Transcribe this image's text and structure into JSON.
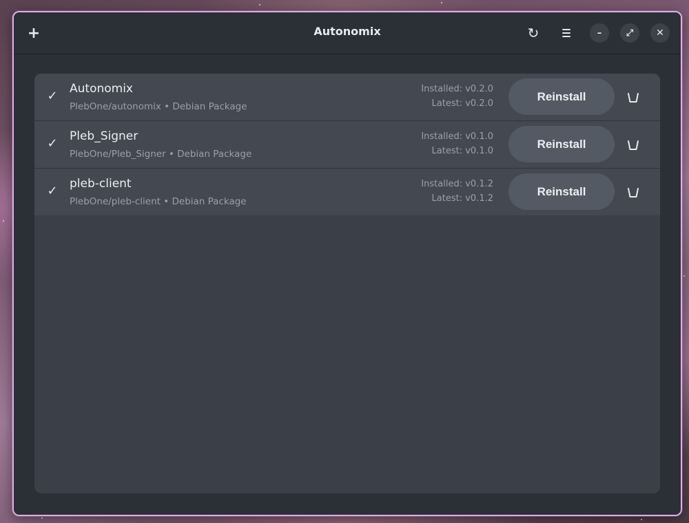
{
  "window": {
    "title": "Autonomix",
    "add_label": "+",
    "refresh_label": "↻",
    "minimize_label": "–",
    "maximize_label": "⤢",
    "close_label": "✕"
  },
  "apps": [
    {
      "name": "Autonomix",
      "subtitle": "PlebOne/autonomix • Debian Package",
      "installed": "Installed: v0.2.0",
      "latest": "Latest: v0.2.0",
      "button": "Reinstall",
      "status_icon": "check-icon",
      "check_label": "✓"
    },
    {
      "name": "Pleb_Signer",
      "subtitle": "PlebOne/Pleb_Signer • Debian Package",
      "installed": "Installed: v0.1.0",
      "latest": "Latest: v0.1.0",
      "button": "Reinstall",
      "status_icon": "check-icon",
      "check_label": "✓"
    },
    {
      "name": "pleb-client",
      "subtitle": "PlebOne/pleb-client • Debian Package",
      "installed": "Installed: v0.1.2",
      "latest": "Latest: v0.1.2",
      "button": "Reinstall",
      "status_icon": "check-icon",
      "check_label": "✓"
    }
  ],
  "colors": {
    "window_border": "#e3a8ec",
    "window_bg": "#2b2f36",
    "card_bg": "#3b3f47",
    "row_bg": "#434851",
    "button_bg": "#545a63",
    "text_primary": "#eceef2",
    "text_secondary": "#9aa0aa"
  },
  "icons": [
    "add-icon",
    "refresh-icon",
    "menu-icon",
    "minimize-icon",
    "maximize-icon",
    "close-icon",
    "check-icon",
    "trash-icon"
  ]
}
